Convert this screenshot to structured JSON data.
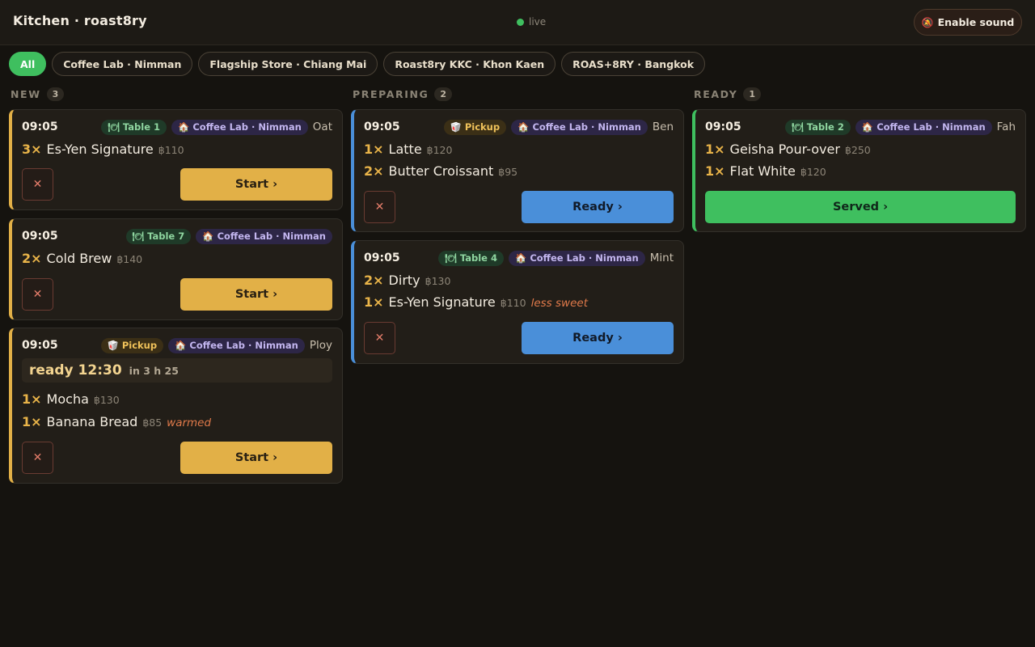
{
  "header": {
    "title": "Kitchen · roast8ry",
    "live_label": "live",
    "sound_button": "Enable sound",
    "sound_icon": "bell-slash-icon"
  },
  "filters": [
    "All",
    "Coffee Lab · Nimman",
    "Flagship Store · Chiang Mai",
    "Roast8ry KKC · Khon Kaen",
    "ROAS+8RY · Bangkok"
  ],
  "columns": {
    "new": {
      "label": "NEW",
      "count": "3"
    },
    "preparing": {
      "label": "PREPARING",
      "count": "2"
    },
    "ready": {
      "label": "READY",
      "count": "1"
    }
  },
  "icons": {
    "table": "fork-knife-icon",
    "pickup": "takeout-box-icon",
    "store": "house-icon"
  },
  "colors": {
    "accent_new": "#e2b047",
    "accent_preparing": "#4a8fd9",
    "accent_ready": "#3fbf5f"
  },
  "orders": {
    "n1": {
      "time": "09:05",
      "type_tag": "Table 1",
      "store": "Coffee Lab · Nimman",
      "customer": "Oat",
      "items": [
        {
          "qty": "3×",
          "name": "Es-Yen Signature",
          "price": "฿110",
          "note": ""
        }
      ],
      "cancel": "✕",
      "action": "Start ›"
    },
    "n2": {
      "time": "09:05",
      "type_tag": "Table 7",
      "store": "Coffee Lab · Nimman",
      "customer": "",
      "items": [
        {
          "qty": "2×",
          "name": "Cold Brew",
          "price": "฿140",
          "note": ""
        }
      ],
      "cancel": "✕",
      "action": "Start ›"
    },
    "n3": {
      "time": "09:05",
      "type_tag": "Pickup",
      "store": "Coffee Lab · Nimman",
      "customer": "Ploy",
      "ready_time": "ready 12:30",
      "ready_in": "in 3 h 25",
      "items": [
        {
          "qty": "1×",
          "name": "Mocha",
          "price": "฿130",
          "note": ""
        },
        {
          "qty": "1×",
          "name": "Banana Bread",
          "price": "฿85",
          "note": "warmed"
        }
      ],
      "cancel": "✕",
      "action": "Start ›"
    },
    "p1": {
      "time": "09:05",
      "type_tag": "Pickup",
      "store": "Coffee Lab · Nimman",
      "customer": "Ben",
      "items": [
        {
          "qty": "1×",
          "name": "Latte",
          "price": "฿120",
          "note": ""
        },
        {
          "qty": "2×",
          "name": "Butter Croissant",
          "price": "฿95",
          "note": ""
        }
      ],
      "cancel": "✕",
      "action": "Ready ›"
    },
    "p2": {
      "time": "09:05",
      "type_tag": "Table 4",
      "store": "Coffee Lab · Nimman",
      "customer": "Mint",
      "items": [
        {
          "qty": "2×",
          "name": "Dirty",
          "price": "฿130",
          "note": ""
        },
        {
          "qty": "1×",
          "name": "Es-Yen Signature",
          "price": "฿110",
          "note": "less sweet"
        }
      ],
      "cancel": "✕",
      "action": "Ready ›"
    },
    "r1": {
      "time": "09:05",
      "type_tag": "Table 2",
      "store": "Coffee Lab · Nimman",
      "customer": "Fah",
      "items": [
        {
          "qty": "1×",
          "name": "Geisha Pour-over",
          "price": "฿250",
          "note": ""
        },
        {
          "qty": "1×",
          "name": "Flat White",
          "price": "฿120",
          "note": ""
        }
      ],
      "action": "Served ›"
    }
  }
}
